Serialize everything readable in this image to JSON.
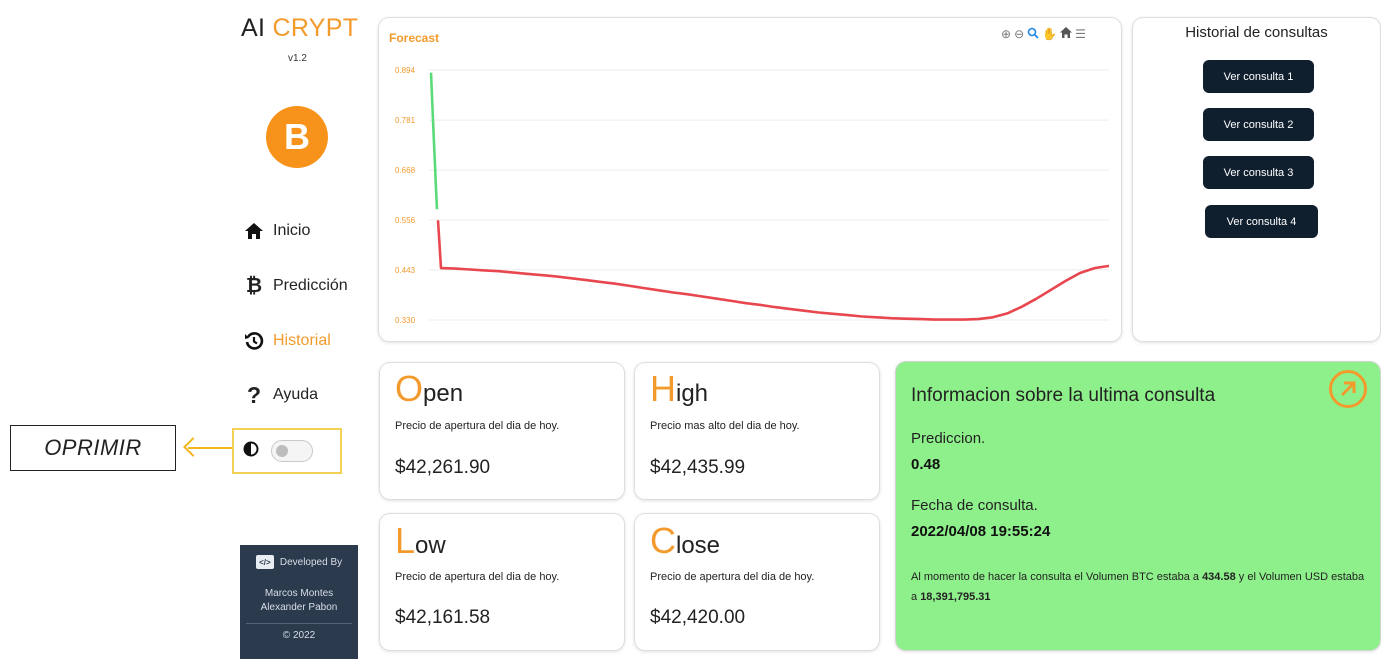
{
  "annotation": {
    "label": "OPRIMIR"
  },
  "sidebar": {
    "brand_prefix": "AI",
    "brand_accent": "CRYPT",
    "version": "v1.2",
    "coin_symbol": "B",
    "nav": [
      {
        "label": "Inicio",
        "icon": "home-icon",
        "active": false
      },
      {
        "label": "Predicción",
        "icon": "bitcoin-icon",
        "active": false
      },
      {
        "label": "Historial",
        "icon": "history-icon",
        "active": true
      },
      {
        "label": "Ayuda",
        "icon": "question-icon",
        "active": false
      }
    ],
    "theme_toggle": {
      "icon": "contrast-icon",
      "on": false
    },
    "developer": {
      "heading": "Developed By",
      "name1": "Marcos Montes",
      "name2": "Alexander Pabon",
      "copyright": "© 2022"
    }
  },
  "chart": {
    "title": "Forecast",
    "toolbar": [
      "zoom-in-icon",
      "zoom-out-icon",
      "magnify-icon",
      "pan-icon",
      "home-icon",
      "menu-icon"
    ]
  },
  "chart_data": {
    "type": "line",
    "title": "Forecast",
    "y_ticks": [
      "0.894",
      "0.781",
      "0.668",
      "0.556",
      "0.443",
      "0.330"
    ],
    "ylim": [
      0.33,
      0.894
    ],
    "grid": true,
    "series": [
      {
        "color": "#5bdb77",
        "values": [
          0.888,
          0.835,
          0.78,
          0.73,
          0.68,
          0.625,
          0.58
        ]
      },
      {
        "color": "#e8474f",
        "values": [
          0.555,
          0.447,
          0.446,
          0.444,
          0.442,
          0.44,
          0.437,
          0.434,
          0.431,
          0.428,
          0.424,
          0.42,
          0.416,
          0.412,
          0.407,
          0.402,
          0.397,
          0.392,
          0.388,
          0.383,
          0.378,
          0.373,
          0.368,
          0.364,
          0.359,
          0.355,
          0.351,
          0.347,
          0.344,
          0.341,
          0.338,
          0.336,
          0.334,
          0.333,
          0.332,
          0.331,
          0.331,
          0.331,
          0.332,
          0.336,
          0.345,
          0.36,
          0.378,
          0.398,
          0.418,
          0.436,
          0.447,
          0.452
        ]
      }
    ]
  },
  "history": {
    "title": "Historial de consultas",
    "buttons": [
      "Ver consulta 1",
      "Ver consulta 2",
      "Ver consulta 3",
      "Ver consulta 4"
    ]
  },
  "prices": {
    "open": {
      "letter": "O",
      "rest": "pen",
      "desc": "Precio de apertura del dia de hoy.",
      "value": "$42,261.90"
    },
    "high": {
      "letter": "H",
      "rest": "igh",
      "desc": "Precio mas alto del dia de hoy.",
      "value": "$42,435.99"
    },
    "low": {
      "letter": "L",
      "rest": "ow",
      "desc": "Precio de apertura del dia de hoy.",
      "value": "$42,161.58"
    },
    "close": {
      "letter": "C",
      "rest": "lose",
      "desc": "Precio de apertura del dia de hoy.",
      "value": "$42,420.00"
    }
  },
  "info": {
    "title": "Informacion sobre la ultima consulta",
    "prediction_label": "Prediccion.",
    "prediction_value": "0.48",
    "date_label": "Fecha de consulta.",
    "date_value": "2022/04/08 19:55:24",
    "text_1": "Al momento de hacer la consulta el Volumen BTC estaba a ",
    "btc_volume": "434.58",
    "text_2": " y el Volumen USD estaba a ",
    "usd_volume": "18,391,795.31",
    "arrow_icon": "arrow-up-right-icon"
  },
  "colors": {
    "accent": "#f39a2d",
    "info_bg": "#8ef08a",
    "button_dark": "#0f1f2e",
    "sidebar_card": "#2b3a4d"
  }
}
